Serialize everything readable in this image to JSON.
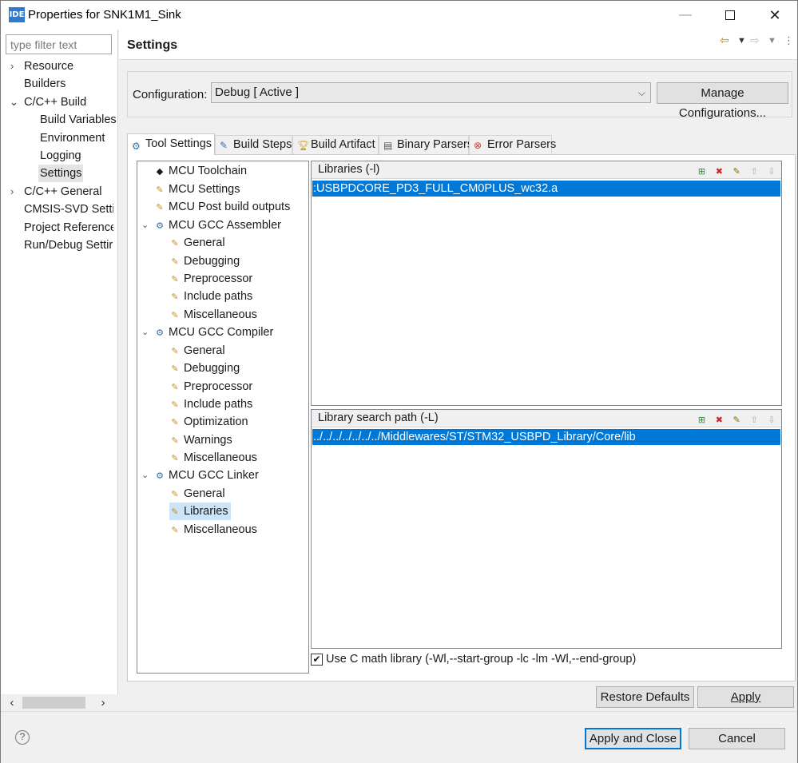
{
  "window": {
    "title": "Properties for SNK1M1_Sink",
    "logo_text": "IDE",
    "minimize": "—",
    "close": "✕"
  },
  "left_panel": {
    "filter_placeholder": "type filter text",
    "items": [
      {
        "label": "Resource",
        "arrow": "›"
      },
      {
        "label": "Builders"
      },
      {
        "label": "C/C++ Build",
        "arrow": "⌄"
      },
      {
        "label": "Build Variables"
      },
      {
        "label": "Environment"
      },
      {
        "label": "Logging"
      },
      {
        "label": "Settings"
      },
      {
        "label": "C/C++ General",
        "arrow": "›"
      },
      {
        "label": "CMSIS-SVD Settir"
      },
      {
        "label": "Project References"
      },
      {
        "label": "Run/Debug Settir"
      }
    ],
    "scroll_left": "‹",
    "scroll_right": "›"
  },
  "main": {
    "title": "Settings",
    "configuration": {
      "label": "Configuration:",
      "value": "Debug  [ Active ]",
      "manage_button": "Manage Configurations..."
    },
    "tabs": [
      {
        "label": "Tool Settings",
        "icon": "tool-settings-icon"
      },
      {
        "label": "Build Steps",
        "icon": "build-steps-icon"
      },
      {
        "label": "Build Artifact",
        "icon": "build-artifact-icon"
      },
      {
        "label": "Binary Parsers",
        "icon": "binary-parsers-icon"
      },
      {
        "label": "Error Parsers",
        "icon": "error-parsers-icon"
      }
    ],
    "tree": [
      {
        "label": "MCU Toolchain"
      },
      {
        "label": "MCU Settings"
      },
      {
        "label": "MCU Post build outputs"
      },
      {
        "label": "MCU GCC Assembler"
      },
      {
        "label": "General"
      },
      {
        "label": "Debugging"
      },
      {
        "label": "Preprocessor"
      },
      {
        "label": "Include paths"
      },
      {
        "label": "Miscellaneous"
      },
      {
        "label": "MCU GCC Compiler"
      },
      {
        "label": "General"
      },
      {
        "label": "Debugging"
      },
      {
        "label": "Preprocessor"
      },
      {
        "label": "Include paths"
      },
      {
        "label": "Optimization"
      },
      {
        "label": "Warnings"
      },
      {
        "label": "Miscellaneous"
      },
      {
        "label": "MCU GCC Linker"
      },
      {
        "label": "General"
      },
      {
        "label": "Libraries"
      },
      {
        "label": "Miscellaneous"
      }
    ],
    "libraries": {
      "title": "Libraries (-l)",
      "items": [
        ":USBPDCORE_PD3_FULL_CM0PLUS_wc32.a"
      ]
    },
    "library_search_path": {
      "title": "Library search path (-L)",
      "items": [
        "../../../../../../../Middlewares/ST/STM32_USBPD_Library/Core/lib"
      ]
    },
    "use_c_math": {
      "label": "Use C math library (-Wl,--start-group -lc -lm -Wl,--end-group)",
      "checked": true
    },
    "restore_defaults": "Restore Defaults",
    "apply": "Apply"
  },
  "footer": {
    "help": "?",
    "apply_and_close": "Apply and Close",
    "cancel": "Cancel"
  },
  "colors": {
    "selection": "#0078d7",
    "tree_selection": "#cce4f7"
  }
}
